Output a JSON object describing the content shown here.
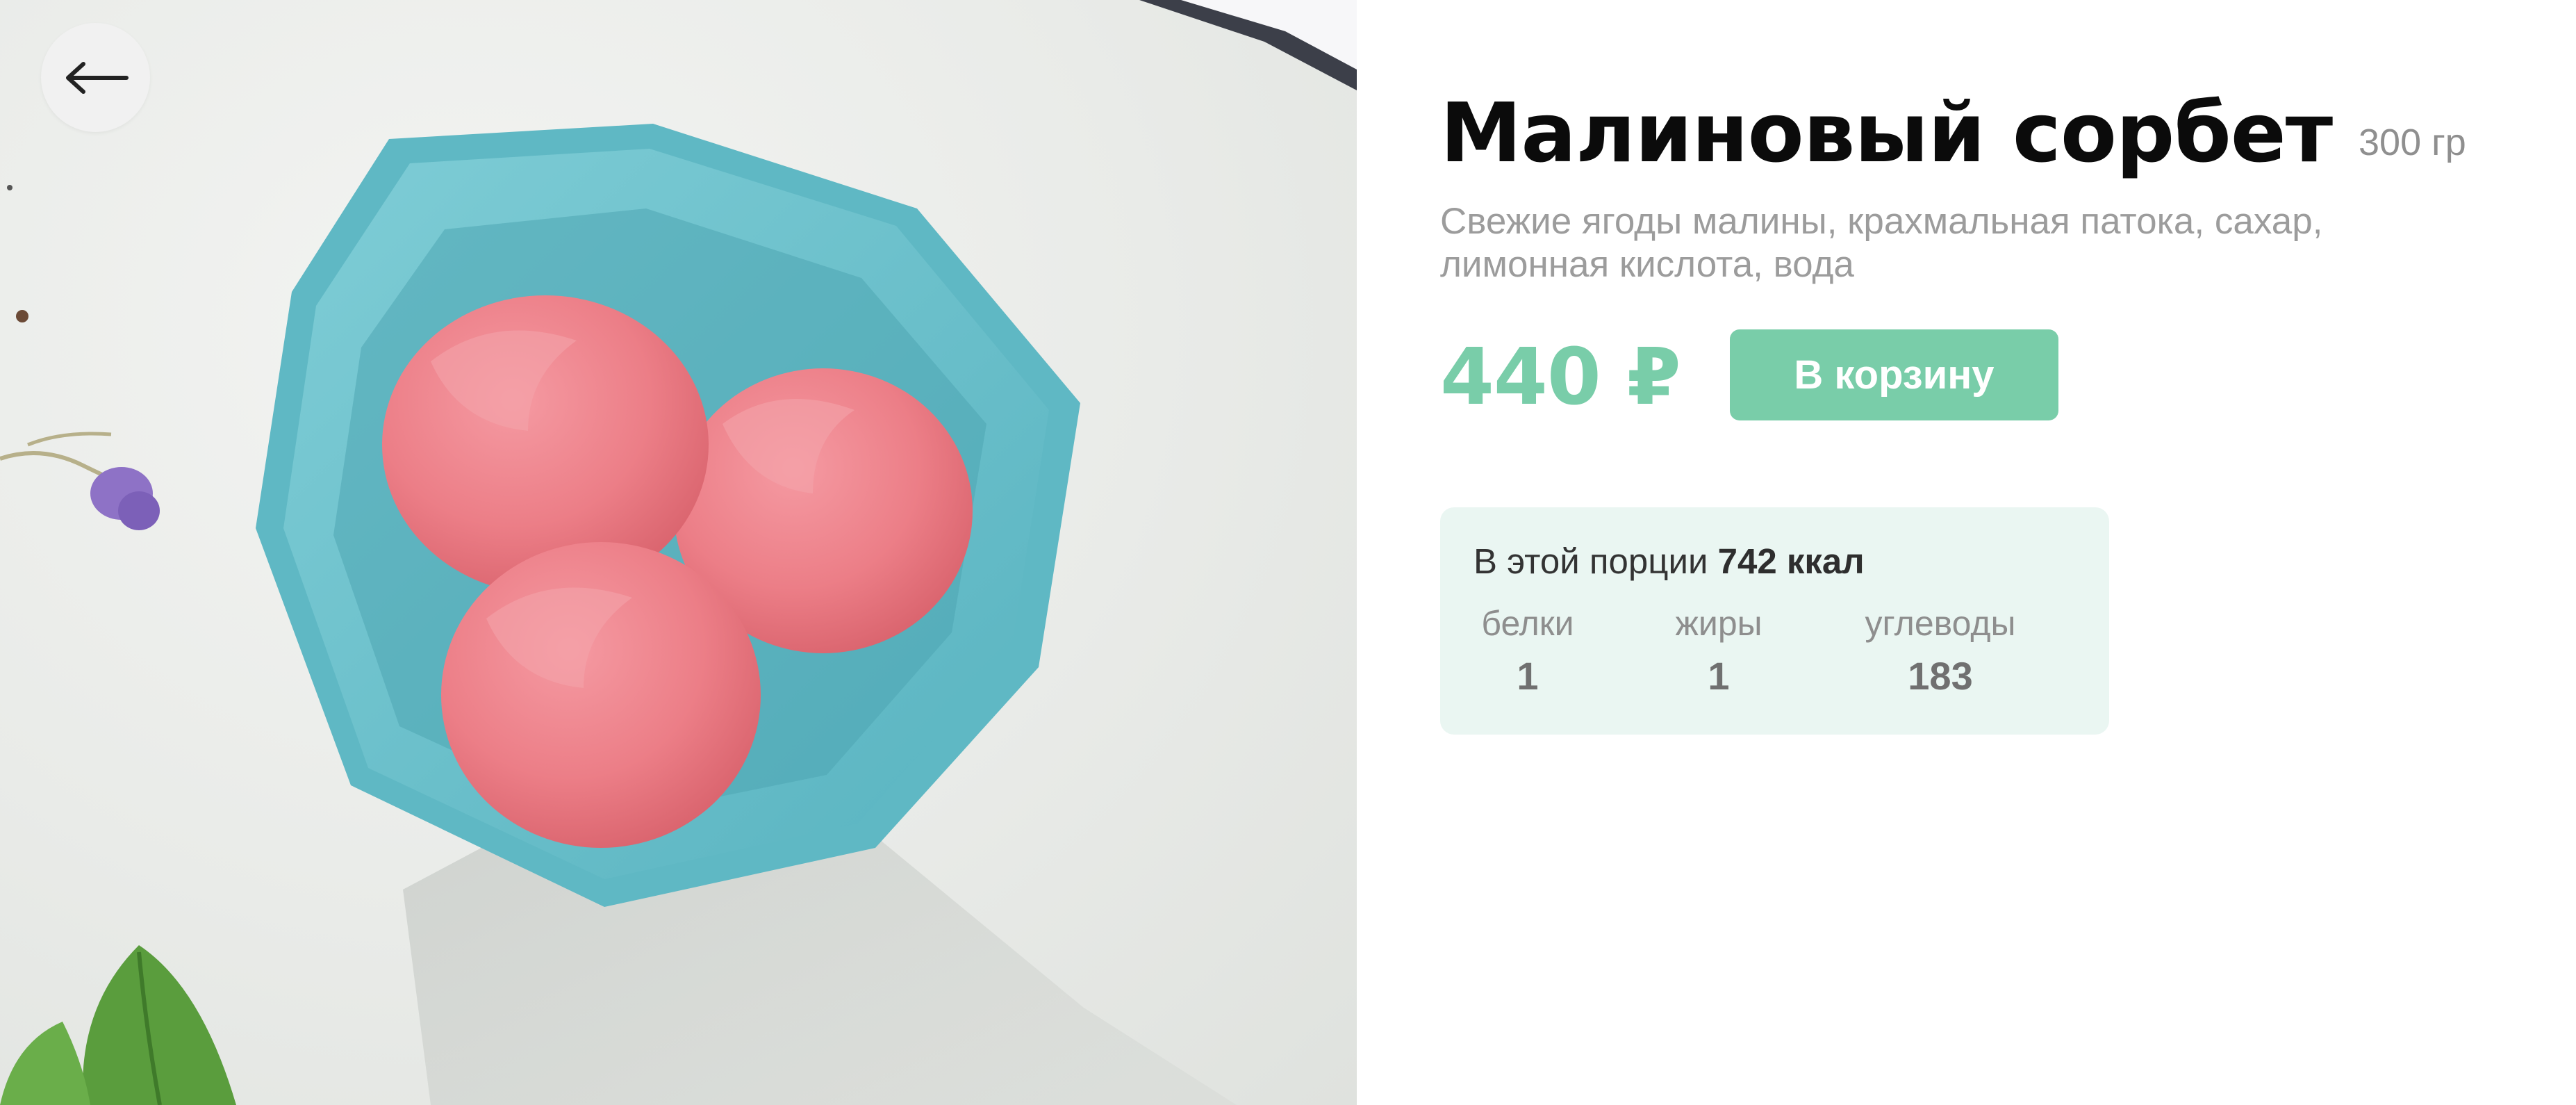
{
  "product": {
    "title": "Малиновый сорбет",
    "weight": "300 гр",
    "description": "Свежие ягоды малины, крахмальная патока, сахар, лимонная кислота, вода",
    "price": "440 ₽",
    "add_to_cart_label": "В корзину"
  },
  "nutrition": {
    "prefix": "В этой порции",
    "kcal": "742 ккал",
    "macros": [
      {
        "label": "белки",
        "value": "1"
      },
      {
        "label": "жиры",
        "value": "1"
      },
      {
        "label": "углеводы",
        "value": "183"
      }
    ]
  },
  "icons": {
    "back": "arrow-left-icon"
  },
  "colors": {
    "accent": "#79cda9",
    "nutrition_bg": "#eaf6f2",
    "title": "#0b0b0b",
    "muted": "#9c9c9c"
  }
}
